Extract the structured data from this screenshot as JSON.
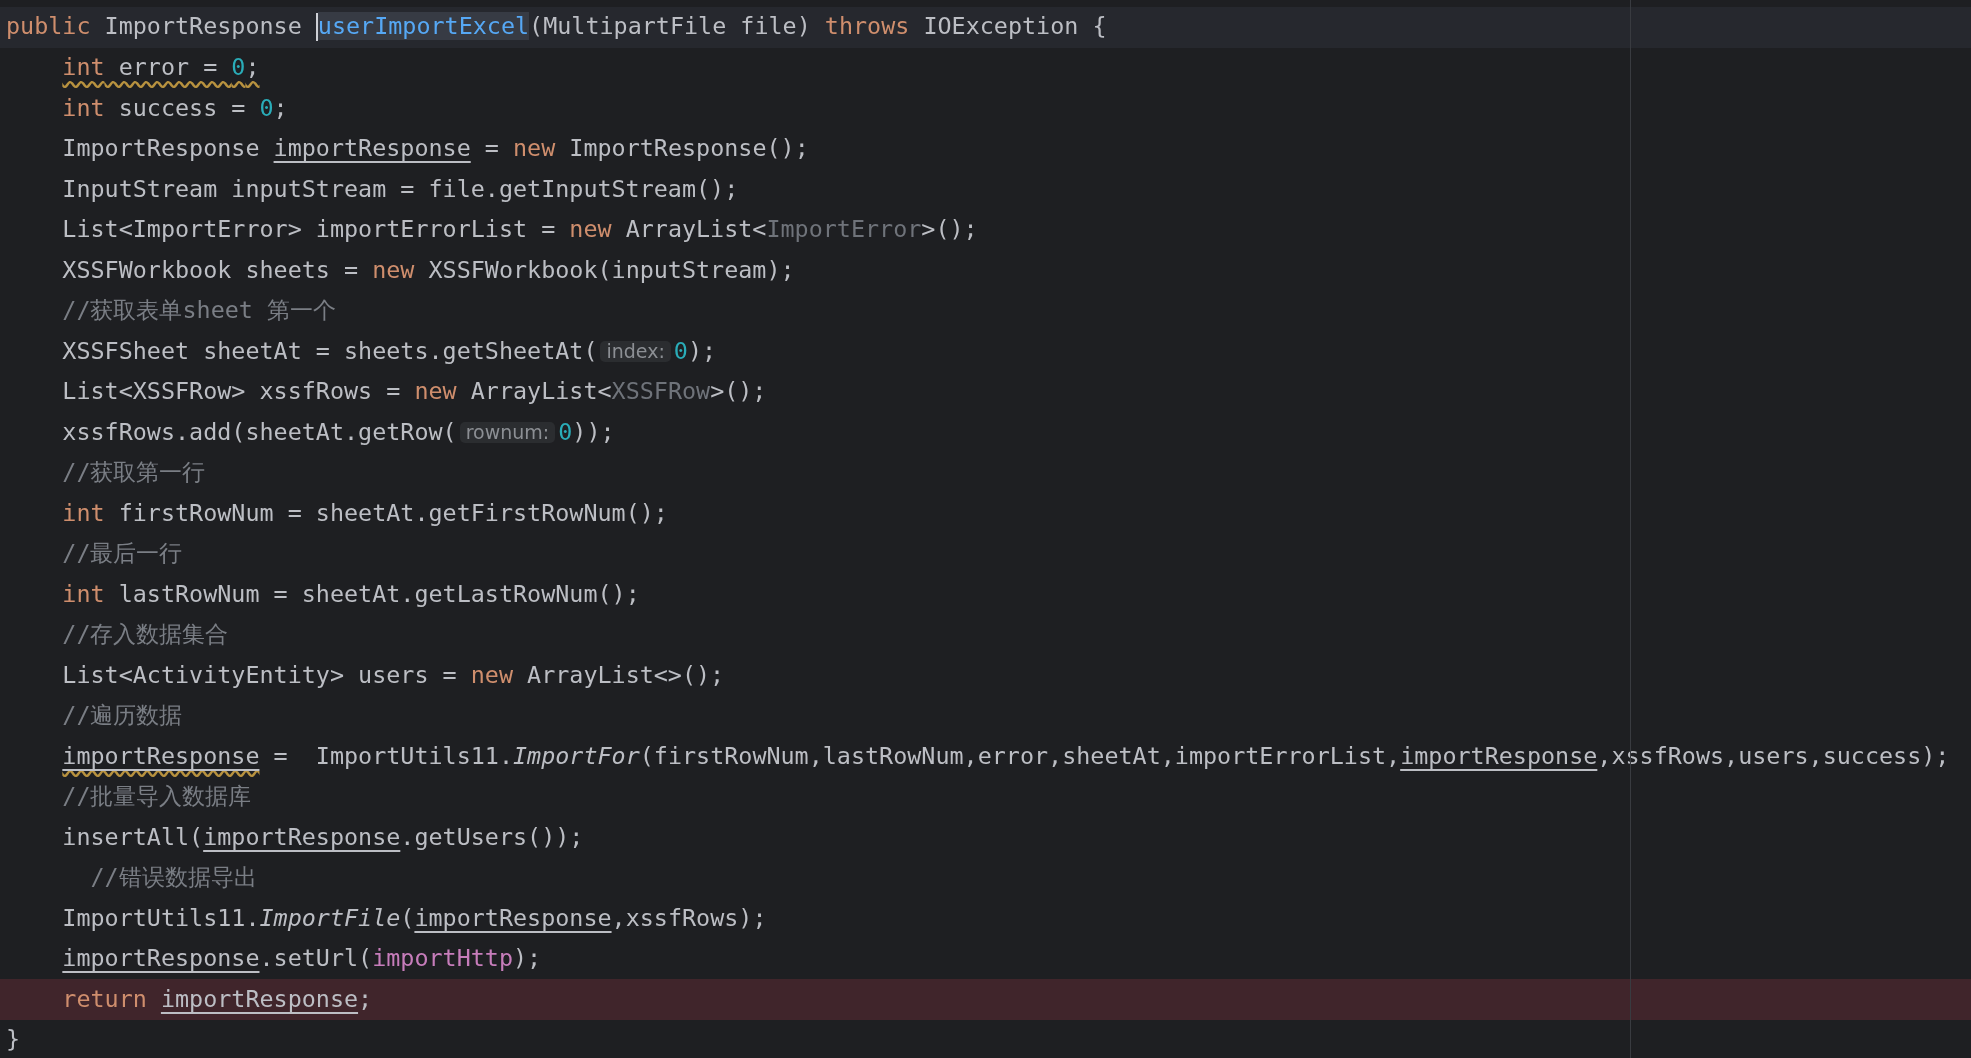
{
  "editor": {
    "lines": [
      {
        "current": true,
        "error": false,
        "tokens": [
          {
            "kind": "kw",
            "text": "public"
          },
          {
            "kind": "plain",
            "text": " ImportResponse "
          },
          {
            "kind": "caret"
          },
          {
            "kind": "decl",
            "text": "userImportExcel"
          },
          {
            "kind": "plain",
            "text": "(MultipartFile file) "
          },
          {
            "kind": "kw",
            "text": "throws"
          },
          {
            "kind": "plain",
            "text": " IOException {"
          }
        ]
      },
      {
        "current": false,
        "error": false,
        "tokens": [
          {
            "kind": "indent"
          },
          {
            "kind": "warning",
            "parts": [
              {
                "kind": "kw",
                "text": "int"
              },
              {
                "kind": "plain",
                "text": " error = "
              },
              {
                "kind": "num",
                "text": "0"
              },
              {
                "kind": "plain",
                "text": ";"
              }
            ]
          }
        ]
      },
      {
        "current": false,
        "error": false,
        "tokens": [
          {
            "kind": "indent"
          },
          {
            "kind": "kw",
            "text": "int"
          },
          {
            "kind": "plain",
            "text": " success = "
          },
          {
            "kind": "num",
            "text": "0"
          },
          {
            "kind": "plain",
            "text": ";"
          }
        ]
      },
      {
        "current": false,
        "error": false,
        "tokens": [
          {
            "kind": "indent"
          },
          {
            "kind": "plain",
            "text": "ImportResponse "
          },
          {
            "kind": "var",
            "text": "importResponse"
          },
          {
            "kind": "plain",
            "text": " = "
          },
          {
            "kind": "kw",
            "text": "new"
          },
          {
            "kind": "plain",
            "text": " ImportResponse();"
          }
        ]
      },
      {
        "current": false,
        "error": false,
        "tokens": [
          {
            "kind": "indent"
          },
          {
            "kind": "plain",
            "text": "InputStream inputStream = file.getInputStream();"
          }
        ]
      },
      {
        "current": false,
        "error": false,
        "tokens": [
          {
            "kind": "indent"
          },
          {
            "kind": "plain",
            "text": "List<ImportError> importErrorList = "
          },
          {
            "kind": "kw",
            "text": "new"
          },
          {
            "kind": "plain",
            "text": " ArrayList<"
          },
          {
            "kind": "gen",
            "text": "ImportError"
          },
          {
            "kind": "plain",
            "text": ">();"
          }
        ]
      },
      {
        "current": false,
        "error": false,
        "tokens": [
          {
            "kind": "indent"
          },
          {
            "kind": "plain",
            "text": "XSSFWorkbook sheets = "
          },
          {
            "kind": "kw",
            "text": "new"
          },
          {
            "kind": "plain",
            "text": " XSSFWorkbook(inputStream);"
          }
        ]
      },
      {
        "current": false,
        "error": false,
        "tokens": [
          {
            "kind": "indent"
          },
          {
            "kind": "comment",
            "text": "//获取表单sheet 第一个"
          }
        ]
      },
      {
        "current": false,
        "error": false,
        "tokens": [
          {
            "kind": "indent"
          },
          {
            "kind": "plain",
            "text": "XSSFSheet sheetAt = sheets.getSheetAt("
          },
          {
            "kind": "hint",
            "text": "index:"
          },
          {
            "kind": "num",
            "text": "0"
          },
          {
            "kind": "plain",
            "text": ");"
          }
        ]
      },
      {
        "current": false,
        "error": false,
        "tokens": [
          {
            "kind": "indent"
          },
          {
            "kind": "plain",
            "text": "List<XSSFRow> xssfRows = "
          },
          {
            "kind": "kw",
            "text": "new"
          },
          {
            "kind": "plain",
            "text": " ArrayList<"
          },
          {
            "kind": "gen",
            "text": "XSSFRow"
          },
          {
            "kind": "plain",
            "text": ">();"
          }
        ]
      },
      {
        "current": false,
        "error": false,
        "tokens": [
          {
            "kind": "indent"
          },
          {
            "kind": "plain",
            "text": "xssfRows.add(sheetAt.getRow("
          },
          {
            "kind": "hint",
            "text": "rownum:"
          },
          {
            "kind": "num",
            "text": "0"
          },
          {
            "kind": "plain",
            "text": "));"
          }
        ]
      },
      {
        "current": false,
        "error": false,
        "tokens": [
          {
            "kind": "indent"
          },
          {
            "kind": "comment",
            "text": "//获取第一行"
          }
        ]
      },
      {
        "current": false,
        "error": false,
        "tokens": [
          {
            "kind": "indent"
          },
          {
            "kind": "kw",
            "text": "int"
          },
          {
            "kind": "plain",
            "text": " firstRowNum = sheetAt.getFirstRowNum();"
          }
        ]
      },
      {
        "current": false,
        "error": false,
        "tokens": [
          {
            "kind": "indent"
          },
          {
            "kind": "comment",
            "text": "//最后一行"
          }
        ]
      },
      {
        "current": false,
        "error": false,
        "tokens": [
          {
            "kind": "indent"
          },
          {
            "kind": "kw",
            "text": "int"
          },
          {
            "kind": "plain",
            "text": " lastRowNum = sheetAt.getLastRowNum();"
          }
        ]
      },
      {
        "current": false,
        "error": false,
        "tokens": [
          {
            "kind": "indent"
          },
          {
            "kind": "comment",
            "text": "//存入数据集合"
          }
        ]
      },
      {
        "current": false,
        "error": false,
        "tokens": [
          {
            "kind": "indent"
          },
          {
            "kind": "plain",
            "text": "List<ActivityEntity> users = "
          },
          {
            "kind": "kw",
            "text": "new"
          },
          {
            "kind": "plain",
            "text": " ArrayList<>();"
          }
        ]
      },
      {
        "current": false,
        "error": false,
        "tokens": [
          {
            "kind": "indent"
          },
          {
            "kind": "comment",
            "text": "//遍历数据"
          }
        ]
      },
      {
        "current": false,
        "error": false,
        "tokens": [
          {
            "kind": "indent"
          },
          {
            "kind": "warning",
            "parts": [
              {
                "kind": "var",
                "text": "importResponse"
              }
            ]
          },
          {
            "kind": "plain",
            "text": " =  ImportUtils11."
          },
          {
            "kind": "static",
            "text": "ImportFor"
          },
          {
            "kind": "plain",
            "text": "(firstRowNum,lastRowNum,error,sheetAt,importErrorList,"
          },
          {
            "kind": "var",
            "text": "importResponse"
          },
          {
            "kind": "plain",
            "text": ",xssfRows,users,success);"
          }
        ]
      },
      {
        "current": false,
        "error": false,
        "tokens": [
          {
            "kind": "indent"
          },
          {
            "kind": "comment",
            "text": "//批量导入数据库"
          }
        ]
      },
      {
        "current": false,
        "error": false,
        "tokens": [
          {
            "kind": "indent"
          },
          {
            "kind": "plain",
            "text": "insertAll("
          },
          {
            "kind": "var",
            "text": "importResponse"
          },
          {
            "kind": "plain",
            "text": ".getUsers());"
          }
        ]
      },
      {
        "current": false,
        "error": false,
        "tokens": [
          {
            "kind": "indent"
          },
          {
            "kind": "half-indent"
          },
          {
            "kind": "comment",
            "text": "//错误数据导出"
          }
        ]
      },
      {
        "current": false,
        "error": false,
        "tokens": [
          {
            "kind": "indent"
          },
          {
            "kind": "plain",
            "text": "ImportUtils11."
          },
          {
            "kind": "static",
            "text": "ImportFile"
          },
          {
            "kind": "plain",
            "text": "("
          },
          {
            "kind": "var",
            "text": "importResponse"
          },
          {
            "kind": "plain",
            "text": ",xssfRows);"
          }
        ]
      },
      {
        "current": false,
        "error": false,
        "tokens": [
          {
            "kind": "indent"
          },
          {
            "kind": "var",
            "text": "importResponse"
          },
          {
            "kind": "plain",
            "text": ".setUrl("
          },
          {
            "kind": "field",
            "text": "importHttp"
          },
          {
            "kind": "plain",
            "text": ");"
          }
        ]
      },
      {
        "current": false,
        "error": true,
        "tokens": [
          {
            "kind": "indent"
          },
          {
            "kind": "kw",
            "text": "return"
          },
          {
            "kind": "space"
          },
          {
            "kind": "var",
            "text": "importResponse"
          },
          {
            "kind": "plain",
            "text": ";"
          }
        ]
      },
      {
        "current": false,
        "error": false,
        "tokens": [
          {
            "kind": "plain",
            "text": "}"
          }
        ]
      }
    ]
  }
}
